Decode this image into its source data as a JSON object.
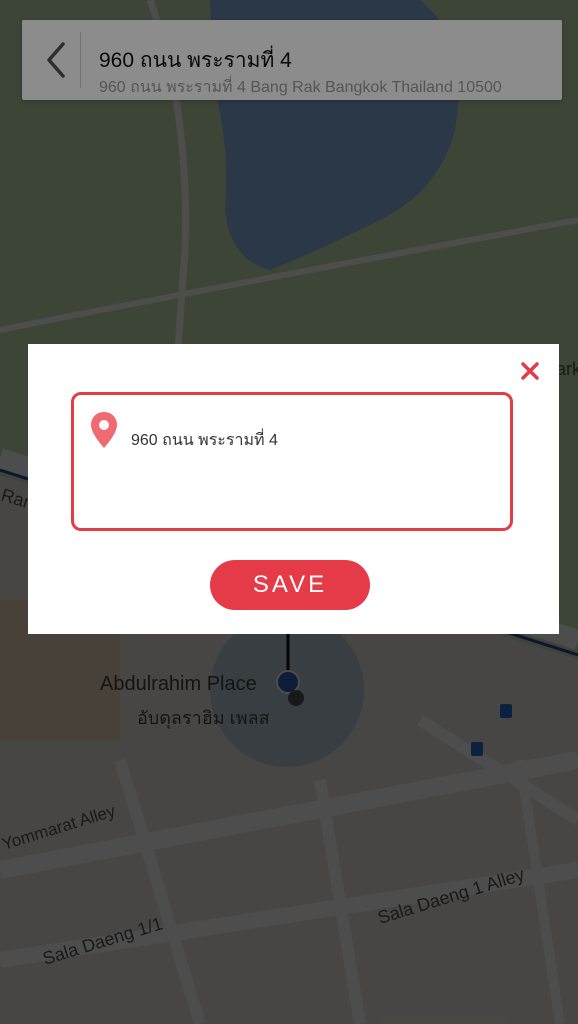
{
  "header": {
    "back_icon": "chevron-left-icon",
    "title": "960 ถนน พระรามที่ 4",
    "subtitle": "960 ถนน พระรามที่ 4 Bang Rak Bangkok Thailand 10500"
  },
  "map": {
    "place_name": "Abdulrahim Place",
    "place_name_thai": "อับดุลราฮิม เพลส",
    "streets": [
      "Yommarat Alley",
      "Sala Daeng 1 Alley",
      "Sala Daeng 1/1"
    ],
    "partial_labels": [
      "Ram",
      "ark"
    ]
  },
  "dialog": {
    "close_icon": "close-icon",
    "location_icon": "location-pin-icon",
    "address_value": "960 ถนน พระรามที่ 4",
    "save_label": "SAVE"
  },
  "colors": {
    "accent": "#e53a47",
    "park": "#cfe7b6",
    "water": "#8bb8ef",
    "road": "#ffffff"
  }
}
